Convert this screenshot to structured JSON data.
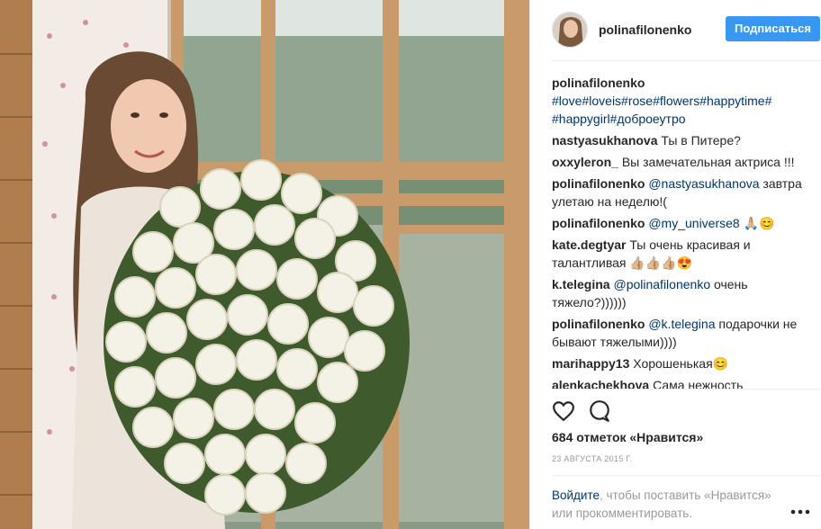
{
  "post": {
    "username": "polinafilonenko",
    "follow_label": "Подписаться",
    "caption": {
      "author": "polinafilonenko",
      "hashtags": "#love#loveis#rose#flowers#happytime# #happygirl#доброеутро"
    },
    "comments": [
      {
        "author": "nastyasukhanova",
        "mention": "",
        "text": "Ты в Питере?"
      },
      {
        "author": "oxxyleron_",
        "mention": "",
        "text": "Вы замечательная актриса !!!"
      },
      {
        "author": "polinafilonenko",
        "mention": "@nastyasukhanova",
        "text": "завтра улетаю на неделю!("
      },
      {
        "author": "polinafilonenko",
        "mention": "@my_universe8",
        "text": "🙏🏼😊"
      },
      {
        "author": "kate.degtyar",
        "mention": "",
        "text": "Ты очень красивая и талантливая 👍🏼👍🏼👍🏼😍"
      },
      {
        "author": "k.telegina",
        "mention": "@polinafilonenko",
        "text": "очень тяжело?))))))"
      },
      {
        "author": "polinafilonenko",
        "mention": "@k.telegina",
        "text": "подарочки не бывают тяжелыми))))"
      },
      {
        "author": "marihappy13",
        "mention": "",
        "text": "Хорошенькая😊"
      },
      {
        "author": "alenkachekhova",
        "mention": "",
        "text": "Сама нежность"
      }
    ],
    "likes_text": "684 отметок «Нравится»",
    "date": "23 АВГУСТА 2015 Г.",
    "login_link": "Войдите",
    "login_text": ", чтобы поставить «Нравится» или прокомментировать.",
    "icons": {
      "like": "heart-icon",
      "comment": "comment-icon",
      "more": "more-icon"
    },
    "colors": {
      "link": "#003569",
      "follow": "#3897f0",
      "muted": "#999999"
    }
  }
}
